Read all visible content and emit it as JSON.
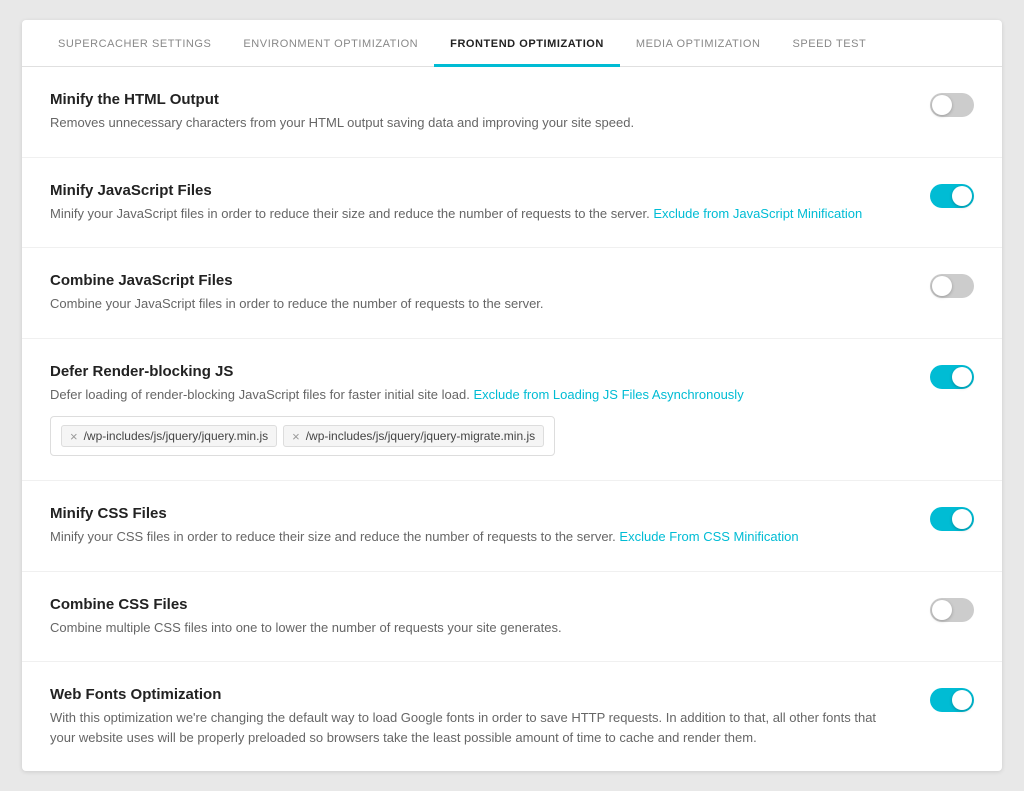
{
  "tabs": [
    {
      "id": "supercacher",
      "label": "SUPERCACHER SETTINGS",
      "active": false
    },
    {
      "id": "environment",
      "label": "ENVIRONMENT OPTIMIZATION",
      "active": false
    },
    {
      "id": "frontend",
      "label": "FRONTEND OPTIMIZATION",
      "active": true
    },
    {
      "id": "media",
      "label": "MEDIA OPTIMIZATION",
      "active": false
    },
    {
      "id": "speed",
      "label": "SPEED TEST",
      "active": false
    }
  ],
  "settings": [
    {
      "id": "minify-html",
      "title": "Minify the HTML Output",
      "desc": "Removes unnecessary characters from your HTML output saving data and improving your site speed.",
      "link": null,
      "link_text": null,
      "enabled": false,
      "type": "toggle"
    },
    {
      "id": "minify-js",
      "title": "Minify JavaScript Files",
      "desc": "Minify your JavaScript files in order to reduce their size and reduce the number of requests to the server.",
      "link": "#",
      "link_text": "Exclude from JavaScript Minification",
      "enabled": true,
      "type": "toggle"
    },
    {
      "id": "combine-js",
      "title": "Combine JavaScript Files",
      "desc": "Combine your JavaScript files in order to reduce the number of requests to the server.",
      "link": null,
      "link_text": null,
      "enabled": false,
      "type": "toggle"
    },
    {
      "id": "defer-js",
      "title": "Defer Render-blocking JS",
      "desc": "Defer loading of render-blocking JavaScript files for faster initial site load.",
      "link": "#",
      "link_text": "Exclude from Loading JS Files Asynchronously",
      "enabled": true,
      "type": "toggle-tags",
      "tags": [
        "/wp-includes/js/jquery/jquery.min.js",
        "/wp-includes/js/jquery/jquery-migrate.min.js"
      ]
    },
    {
      "id": "minify-css",
      "title": "Minify CSS Files",
      "desc": "Minify your CSS files in order to reduce their size and reduce the number of requests to the server.",
      "link": "#",
      "link_text": "Exclude From CSS Minification",
      "enabled": true,
      "type": "toggle"
    },
    {
      "id": "combine-css",
      "title": "Combine CSS Files",
      "desc": "Combine multiple CSS files into one to lower the number of requests your site generates.",
      "link": null,
      "link_text": null,
      "enabled": false,
      "type": "toggle"
    },
    {
      "id": "web-fonts",
      "title": "Web Fonts Optimization",
      "desc": "With this optimization we're changing the default way to load Google fonts in order to save HTTP requests. In addition to that, all other fonts that your website uses will be properly preloaded so browsers take the least possible amount of time to cache and render them.",
      "link": null,
      "link_text": null,
      "enabled": true,
      "type": "toggle"
    }
  ]
}
